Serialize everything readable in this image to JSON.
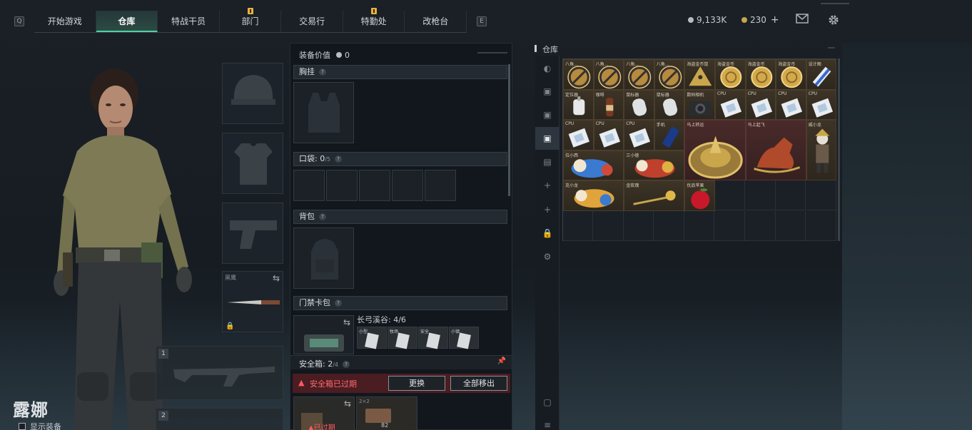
{
  "keys": {
    "left": "Q",
    "right": "E"
  },
  "tabs": [
    {
      "label": "开始游戏",
      "active": false,
      "flag": false
    },
    {
      "label": "仓库",
      "active": true,
      "flag": false
    },
    {
      "label": "特战干员",
      "active": false,
      "flag": false
    },
    {
      "label": "部门",
      "active": false,
      "flag": true
    },
    {
      "label": "交易行",
      "active": false,
      "flag": false
    },
    {
      "label": "特勤处",
      "active": false,
      "flag": true
    },
    {
      "label": "改枪台",
      "active": false,
      "flag": false
    }
  ],
  "currency": {
    "silver": "9,133K",
    "gold": "230",
    "plus": "+"
  },
  "character": {
    "name": "露娜",
    "show_equipment": "显示装备"
  },
  "equipment": {
    "value_label": "装备价值",
    "value": "0",
    "melee_label": "黑鹰"
  },
  "sections": {
    "chest_rig": "胸挂",
    "pocket_label": "口袋",
    "pocket_count": "0",
    "pocket_cap": "/5",
    "backpack": "背包",
    "keycard": "门禁卡包",
    "keycard_info": "长弓溪谷: 4/6",
    "keycards": [
      "小型",
      "牧场",
      "安全",
      "小镇"
    ],
    "safe_label": "安全箱",
    "safe_count": "2",
    "safe_cap": "/4",
    "safe_expired": "安全箱已过期",
    "replace_button": "更换",
    "remove_all_button": "全部移出",
    "expired_tag": "已过期",
    "safe_item_value": "82",
    "safe_item_size": "2×2"
  },
  "weapon_slots": [
    "1",
    "2"
  ],
  "warehouse": {
    "title": "仓库",
    "items": [
      {
        "col": 0,
        "row": 0,
        "w": 1,
        "h": 1,
        "name": "八角...",
        "icon": "forbidden-coin",
        "red": false
      },
      {
        "col": 1,
        "row": 0,
        "w": 1,
        "h": 1,
        "name": "八角...",
        "icon": "forbidden-coin",
        "red": false
      },
      {
        "col": 2,
        "row": 0,
        "w": 1,
        "h": 1,
        "name": "八角...",
        "icon": "forbidden-coin",
        "red": false
      },
      {
        "col": 3,
        "row": 0,
        "w": 1,
        "h": 1,
        "name": "八角...",
        "icon": "forbidden-coin",
        "red": false
      },
      {
        "col": 4,
        "row": 0,
        "w": 1,
        "h": 1,
        "name": "海盗金币鼠",
        "icon": "pyramid",
        "red": false
      },
      {
        "col": 5,
        "row": 0,
        "w": 1,
        "h": 1,
        "name": "海盗金币",
        "icon": "gold-coin",
        "red": false
      },
      {
        "col": 6,
        "row": 0,
        "w": 1,
        "h": 1,
        "name": "海盗金币",
        "icon": "gold-coin",
        "red": false
      },
      {
        "col": 7,
        "row": 0,
        "w": 1,
        "h": 1,
        "name": "海盗金币",
        "icon": "gold-coin",
        "red": false
      },
      {
        "col": 8,
        "row": 0,
        "w": 1,
        "h": 1,
        "name": "设计图",
        "icon": "blue-device",
        "red": false
      },
      {
        "col": 0,
        "row": 1,
        "w": 1,
        "h": 1,
        "name": "定位器",
        "icon": "tracker",
        "red": false
      },
      {
        "col": 1,
        "row": 1,
        "w": 1,
        "h": 1,
        "name": "咖啡",
        "icon": "bottle",
        "red": false
      },
      {
        "col": 2,
        "row": 1,
        "w": 1,
        "h": 1,
        "name": "鼠标器",
        "icon": "mouse",
        "red": false
      },
      {
        "col": 3,
        "row": 1,
        "w": 1,
        "h": 1,
        "name": "鼠标器",
        "icon": "mouse",
        "red": false
      },
      {
        "col": 4,
        "row": 1,
        "w": 1,
        "h": 1,
        "name": "数码相机",
        "icon": "camera",
        "red": false
      },
      {
        "col": 5,
        "row": 1,
        "w": 1,
        "h": 1,
        "name": "CPU",
        "icon": "cpu",
        "red": false
      },
      {
        "col": 6,
        "row": 1,
        "w": 1,
        "h": 1,
        "name": "CPU",
        "icon": "cpu",
        "red": false
      },
      {
        "col": 7,
        "row": 1,
        "w": 1,
        "h": 1,
        "name": "CPU",
        "icon": "cpu",
        "red": false
      },
      {
        "col": 8,
        "row": 1,
        "w": 1,
        "h": 1,
        "name": "CPU",
        "icon": "cpu",
        "red": false
      },
      {
        "col": 0,
        "row": 2,
        "w": 1,
        "h": 1,
        "name": "CPU",
        "icon": "cpu",
        "red": false
      },
      {
        "col": 1,
        "row": 2,
        "w": 1,
        "h": 1,
        "name": "CPU",
        "icon": "cpu",
        "red": false
      },
      {
        "col": 2,
        "row": 2,
        "w": 1,
        "h": 1,
        "name": "CPU",
        "icon": "cpu",
        "red": false
      },
      {
        "col": 3,
        "row": 2,
        "w": 1,
        "h": 1,
        "name": "手机",
        "icon": "phone",
        "red": false
      },
      {
        "col": 4,
        "row": 2,
        "w": 2,
        "h": 2,
        "name": "马上转运",
        "icon": "golden-wheel",
        "red": true
      },
      {
        "col": 6,
        "row": 2,
        "w": 2,
        "h": 2,
        "name": "马上起飞",
        "icon": "red-horse",
        "red": true
      },
      {
        "col": 8,
        "row": 2,
        "w": 1,
        "h": 2,
        "name": "威小龙",
        "icon": "figure",
        "red": false
      },
      {
        "col": 0,
        "row": 3,
        "w": 2,
        "h": 1,
        "name": "拉小西",
        "icon": "toy-blue",
        "red": false
      },
      {
        "col": 2,
        "row": 3,
        "w": 2,
        "h": 1,
        "name": "三小德",
        "icon": "toy-red",
        "red": false
      },
      {
        "col": 0,
        "row": 4,
        "w": 2,
        "h": 1,
        "name": "克小龙",
        "icon": "toy-yellow",
        "red": false
      },
      {
        "col": 2,
        "row": 4,
        "w": 2,
        "h": 1,
        "name": "金玫瑰",
        "icon": "gold-rose",
        "red": false
      },
      {
        "col": 4,
        "row": 4,
        "w": 1,
        "h": 1,
        "name": "优品苹果",
        "icon": "apple",
        "red": false
      }
    ]
  },
  "colors": {
    "accent": "#4fd1a0",
    "warning": "#e0424b",
    "flag": "#e3b341"
  }
}
